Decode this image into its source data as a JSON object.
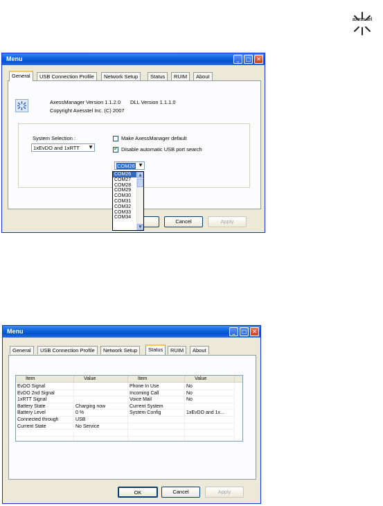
{
  "logo": {
    "brand": "axess·tel"
  },
  "window1": {
    "title": "Menu",
    "tabs": [
      "General",
      "USB Connection Profile",
      "Network Setup",
      "Status",
      "RUIM",
      "About"
    ],
    "active_tab": "General",
    "version_text": "AxessManager Version 1.1.2.0",
    "dll_text": "DLL Version 1.1.1.0",
    "copyright": "Copyright Axesstel Inc. (C) 2007",
    "system_selection_label": "System Selection :",
    "system_selection_value": "1xEvDO and 1xRTT",
    "make_default_label": "Make AxessManager default",
    "make_default_checked": false,
    "disable_usb_label": "Disable automatic USB port search",
    "disable_usb_checked": true,
    "com_port_value": "COM26",
    "com_port_options": [
      "COM26",
      "COM27",
      "COM28",
      "COM29",
      "COM30",
      "COM31",
      "COM32",
      "COM33",
      "COM34"
    ],
    "buttons": {
      "cancel": "Cancel",
      "apply": "Apply"
    }
  },
  "window2": {
    "title": "Menu",
    "tabs": [
      "General",
      "USB Connection Profile",
      "Network Setup",
      "Status",
      "RUIM",
      "About"
    ],
    "active_tab": "Status",
    "table_headers": [
      "Item",
      "Value",
      "Item",
      "Value"
    ],
    "rows": [
      [
        "EvDO Signal",
        "",
        "Phone In Use",
        "No"
      ],
      [
        "EvDO 2nd Signal",
        "",
        "Incoming Call",
        "No"
      ],
      [
        "1xRTT Signal",
        "",
        "Voice Mail",
        "No"
      ],
      [
        "Battery State",
        "Charging now",
        "Current System",
        ""
      ],
      [
        "Battery Level",
        "0 %",
        "System Config",
        "1xEvDO and 1x..."
      ],
      [
        "Connected through",
        "USB",
        "",
        ""
      ],
      [
        "Current State",
        "No Service",
        "",
        ""
      ]
    ],
    "buttons": {
      "ok": "OK",
      "cancel": "Cancel",
      "apply": "Apply"
    }
  },
  "title_buttons": {
    "minimize": "_",
    "maximize": "□",
    "close": "✕"
  },
  "colors": {
    "title_bar": "#0653d1",
    "window_bg": "#ece9d8",
    "tab_highlight": "#ffc83c",
    "selection": "#316ac5"
  }
}
